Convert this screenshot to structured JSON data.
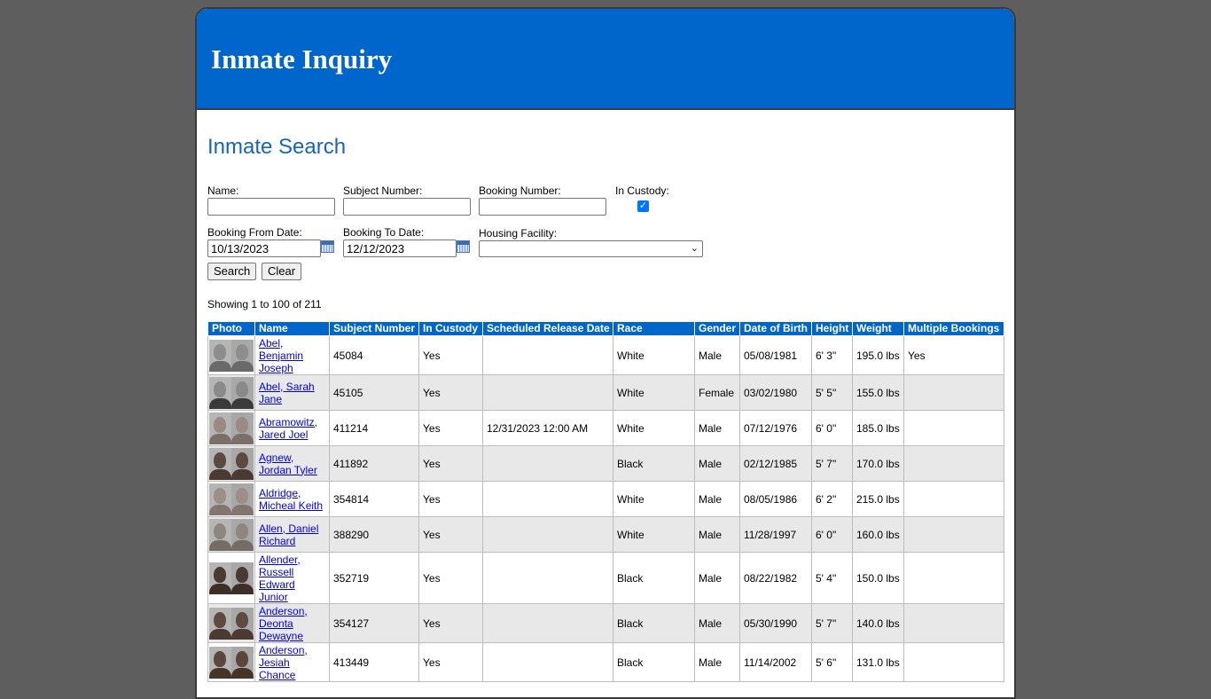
{
  "header": {
    "title": "Inmate Inquiry"
  },
  "search": {
    "title": "Inmate Search",
    "name_label": "Name:",
    "name_value": "",
    "subject_label": "Subject Number:",
    "subject_value": "",
    "booking_label": "Booking Number:",
    "booking_value": "",
    "custody_label": "In Custody:",
    "custody_checked": true,
    "from_label": "Booking From Date:",
    "from_value": "10/13/2023",
    "to_label": "Booking To Date:",
    "to_value": "12/12/2023",
    "facility_label": "Housing Facility:",
    "facility_value": "",
    "search_button": "Search",
    "clear_button": "Clear"
  },
  "results": {
    "showing": "Showing 1 to 100 of 211",
    "columns": [
      "Photo",
      "Name",
      "Subject Number",
      "In Custody",
      "Scheduled Release Date",
      "Race",
      "Gender",
      "Date of Birth",
      "Height",
      "Weight",
      "Multiple Bookings"
    ],
    "rows": [
      {
        "name": "Abel, Benjamin Joseph",
        "subject": "45084",
        "custody": "Yes",
        "release": "",
        "race": "White",
        "gender": "Male",
        "dob": "05/08/1981",
        "height": "6' 3\"",
        "weight": "195.0 lbs",
        "multiple": "Yes"
      },
      {
        "name": "Abel, Sarah Jane",
        "subject": "45105",
        "custody": "Yes",
        "release": "",
        "race": "White",
        "gender": "Female",
        "dob": "03/02/1980",
        "height": "5' 5\"",
        "weight": "155.0 lbs",
        "multiple": ""
      },
      {
        "name": "Abramowitz, Jared Joel",
        "subject": "411214",
        "custody": "Yes",
        "release": "12/31/2023 12:00 AM",
        "race": "White",
        "gender": "Male",
        "dob": "07/12/1976",
        "height": "6' 0\"",
        "weight": "185.0 lbs",
        "multiple": ""
      },
      {
        "name": "Agnew, Jordan Tyler",
        "subject": "411892",
        "custody": "Yes",
        "release": "",
        "race": "Black",
        "gender": "Male",
        "dob": "02/12/1985",
        "height": "5' 7\"",
        "weight": "170.0 lbs",
        "multiple": ""
      },
      {
        "name": "Aldridge, Micheal Keith",
        "subject": "354814",
        "custody": "Yes",
        "release": "",
        "race": "White",
        "gender": "Male",
        "dob": "08/05/1986",
        "height": "6' 2\"",
        "weight": "215.0 lbs",
        "multiple": ""
      },
      {
        "name": "Allen, Daniel Richard",
        "subject": "388290",
        "custody": "Yes",
        "release": "",
        "race": "White",
        "gender": "Male",
        "dob": "11/28/1997",
        "height": "6' 0\"",
        "weight": "160.0 lbs",
        "multiple": ""
      },
      {
        "name": "Allender, Russell Edward Junior",
        "subject": "352719",
        "custody": "Yes",
        "release": "",
        "race": "Black",
        "gender": "Male",
        "dob": "08/22/1982",
        "height": "5' 4\"",
        "weight": "150.0 lbs",
        "multiple": ""
      },
      {
        "name": "Anderson, Deonta Dewayne",
        "subject": "354127",
        "custody": "Yes",
        "release": "",
        "race": "Black",
        "gender": "Male",
        "dob": "05/30/1990",
        "height": "5' 7\"",
        "weight": "140.0 lbs",
        "multiple": ""
      },
      {
        "name": "Anderson, Jesiah Chance",
        "subject": "413449",
        "custody": "Yes",
        "release": "",
        "race": "Black",
        "gender": "Male",
        "dob": "11/14/2002",
        "height": "5' 6\"",
        "weight": "131.0 lbs",
        "multiple": ""
      }
    ]
  },
  "photo_tones": [
    [
      "#8d8d8d",
      "#6a6a6a"
    ],
    [
      "#8a8a8a",
      "#3a3a3a"
    ],
    [
      "#9a8a84",
      "#7c6f6a"
    ],
    [
      "#5b4a42",
      "#4a3a33"
    ],
    [
      "#9d8f88",
      "#837570"
    ],
    [
      "#8f8680",
      "#756c66"
    ],
    [
      "#4a3a32",
      "#3d2f28"
    ],
    [
      "#5e4b40",
      "#4a3a32"
    ],
    [
      "#5a463b",
      "#453529"
    ]
  ]
}
